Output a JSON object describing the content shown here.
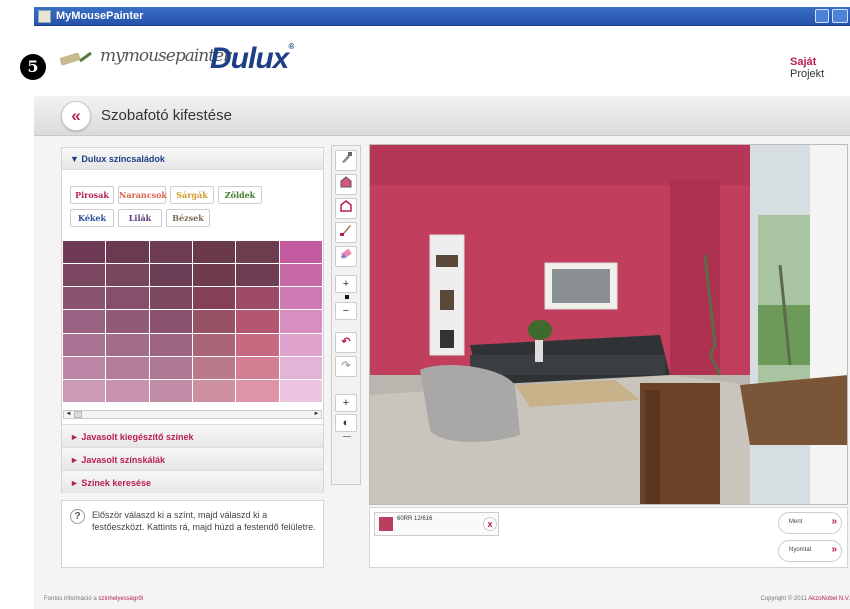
{
  "window": {
    "title": "MyMousePainter"
  },
  "step_badge": "5",
  "logo": {
    "script": "mymousepainter",
    "brand": "Dulux",
    "brand_mark": "®"
  },
  "header": {
    "project_link_bold": "Saját",
    "project_link_rest": " Projekt"
  },
  "page": {
    "title": "Szobafotó kifestése",
    "back_label": "«"
  },
  "palette": {
    "heading": "▼ Dulux színcsaládok",
    "families": [
      {
        "label": "Pirosak",
        "color": "#b8214f"
      },
      {
        "label": "Narancsok",
        "color": "#d8624a"
      },
      {
        "label": "Sárgák",
        "color": "#d49a2c"
      },
      {
        "label": "Zöldek",
        "color": "#3f7c2d"
      },
      {
        "label": "Kékek",
        "color": "#2c4d9a"
      },
      {
        "label": "Lilák",
        "color": "#5b3a7a"
      },
      {
        "label": "Bézsek",
        "color": "#7c6a55"
      }
    ],
    "swatches": [
      [
        "#6e3a55",
        "#6a3a50",
        "#6e3d54",
        "#6b3a4a",
        "#6d3d50",
        "#c45aa0"
      ],
      [
        "#7a4660",
        "#75465c",
        "#6c3e56",
        "#6f3c4e",
        "#6f3d51",
        "#c86aa8"
      ],
      [
        "#8a5470",
        "#84506b",
        "#7b4860",
        "#854058",
        "#9d4a68",
        "#d07cb4"
      ],
      [
        "#9a6282",
        "#915a78",
        "#8a526c",
        "#975266",
        "#b25672",
        "#d88ec0"
      ],
      [
        "#a97292",
        "#a36c88",
        "#9c6480",
        "#aa6478",
        "#c66a82",
        "#dea2cc"
      ],
      [
        "#bc86a6",
        "#b47e9a",
        "#ae7892",
        "#bb7a8c",
        "#d47e94",
        "#e4b4d6"
      ],
      [
        "#cb9ab6",
        "#c692ae",
        "#c08ca6",
        "#cc90a0",
        "#de94a8",
        "#ecc6e0"
      ]
    ],
    "scroll_left": "◄",
    "scroll_right": "►",
    "accordion": [
      "► Javasolt kiegészítő színek",
      "► Javasolt színskálák",
      "► Színek keresése"
    ]
  },
  "help": {
    "icon": "?",
    "text": "Először válaszd ki a színt, majd válaszd ki a festőeszközt. Kattints rá, majd húzd a festendő felületre."
  },
  "tools": [
    "picker-icon",
    "fill-icon",
    "eraser-fill-icon",
    "brush-icon",
    "eraser-icon",
    "zoom-in-icon",
    "zoom-out-icon",
    "undo-icon",
    "redo-icon",
    "contrast-plus-icon",
    "contrast-icon"
  ],
  "selected_color": {
    "code": "60RR 12/616",
    "swatch": "#b8405e",
    "remove": "x"
  },
  "actions": {
    "save": "Ment",
    "print": "Nyomtat",
    "arrows": "»"
  },
  "footer": {
    "left_text": "Fontos információ a",
    "left_link": "színhelyességről",
    "right_text": "Copyright © 2011",
    "right_link": "AkzoNobel N.V."
  }
}
